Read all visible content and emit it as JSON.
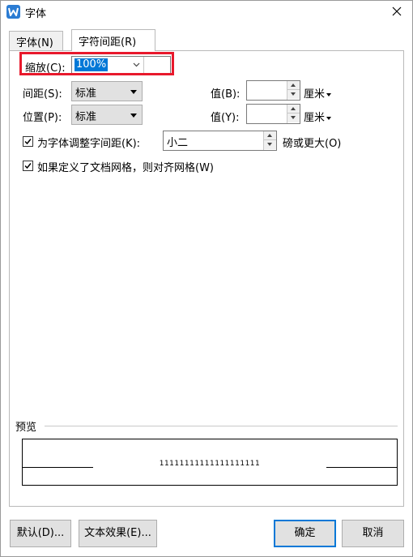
{
  "window": {
    "title": "字体"
  },
  "tabs": [
    {
      "label": "字体(N)",
      "active": false
    },
    {
      "label": "字符间距(R)",
      "active": true
    }
  ],
  "scale": {
    "label": "缩放(C):",
    "value": "100%"
  },
  "spacing": {
    "label": "间距(S):",
    "value": "标准",
    "amount_label": "值(B):",
    "amount_value": "",
    "unit": "厘米"
  },
  "position": {
    "label": "位置(P):",
    "value": "标准",
    "amount_label": "值(Y):",
    "amount_value": "",
    "unit": "厘米"
  },
  "kerning": {
    "label": "为字体调整字间距(K):",
    "checked": true,
    "value": "小二",
    "suffix": "磅或更大(O)"
  },
  "grid_snap": {
    "label": "如果定义了文档网格，则对齐网格(W)",
    "checked": true
  },
  "preview": {
    "label": "预览",
    "sample": "11111111111111111111"
  },
  "buttons": {
    "default_label": "默认(D)...",
    "text_effects_label": "文本效果(E)...",
    "ok_label": "确定",
    "cancel_label": "取消"
  },
  "colors": {
    "highlight": "#e8192c",
    "selection": "#0078d7",
    "accent": "#0078d7"
  }
}
